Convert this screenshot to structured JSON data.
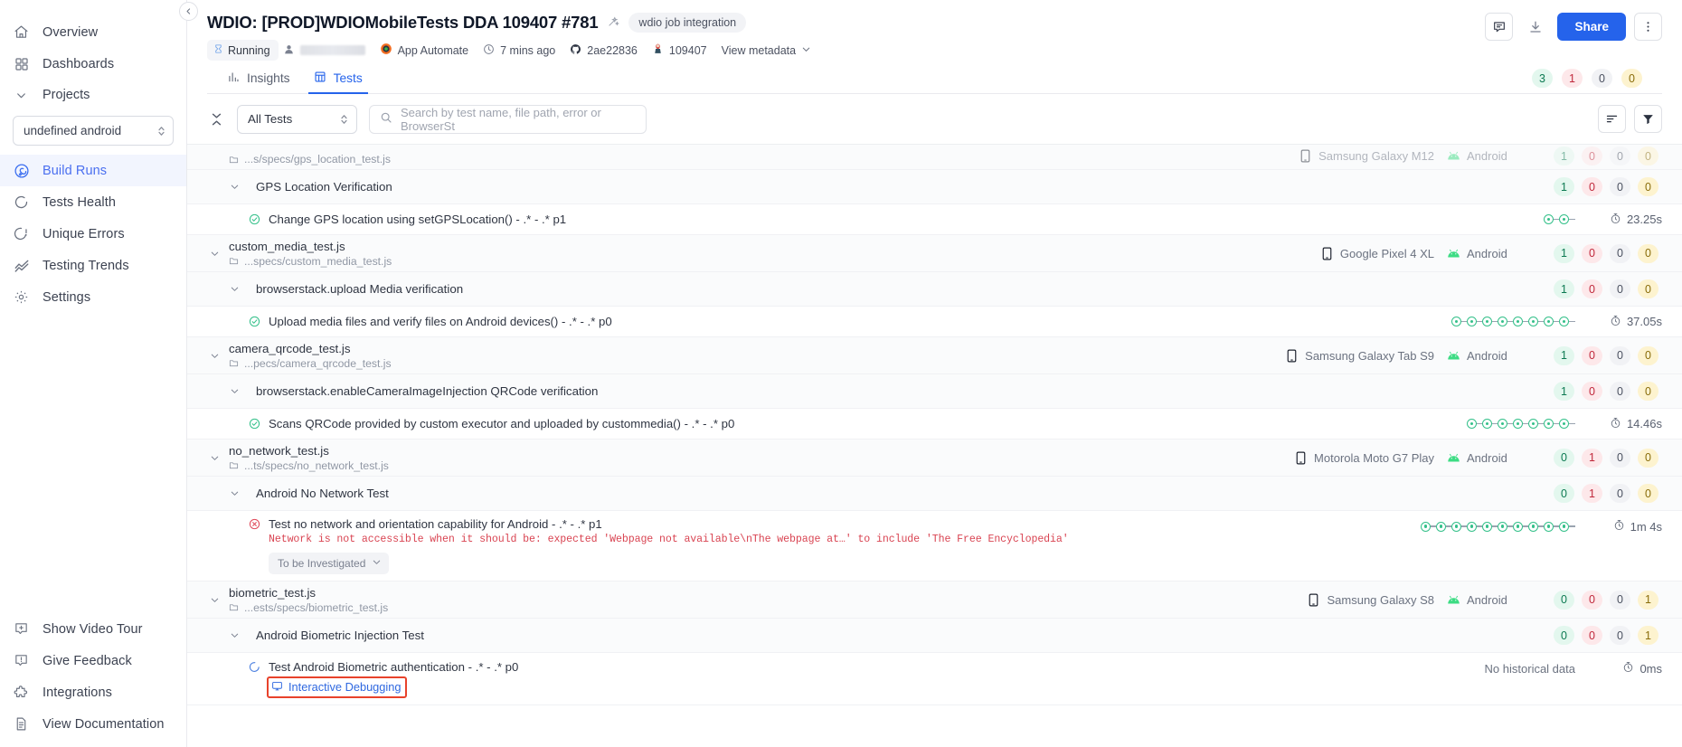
{
  "sidebar": {
    "items_top": [
      {
        "label": "Overview",
        "icon": "home-icon",
        "active": false
      },
      {
        "label": "Dashboards",
        "icon": "grid-icon",
        "active": false
      }
    ],
    "group_label": "Projects",
    "project_select": {
      "value": "undefined android"
    },
    "items_project": [
      {
        "label": "Build Runs",
        "icon": "build-runs-icon",
        "active": true
      },
      {
        "label": "Tests Health",
        "icon": "health-icon",
        "active": false
      },
      {
        "label": "Unique Errors",
        "icon": "unique-errors-icon",
        "active": false
      },
      {
        "label": "Testing Trends",
        "icon": "trends-icon",
        "active": false
      },
      {
        "label": "Settings",
        "icon": "gear-icon",
        "active": false
      }
    ],
    "items_bottom": [
      {
        "label": "Show Video Tour",
        "icon": "video-tour-icon"
      },
      {
        "label": "Give Feedback",
        "icon": "feedback-icon"
      },
      {
        "label": "Integrations",
        "icon": "integrations-icon"
      },
      {
        "label": "View Documentation",
        "icon": "document-icon"
      }
    ]
  },
  "header": {
    "title": "WDIO: [PROD]WDIOMobileTests DDA 109407 #781",
    "tag": "wdio job integration",
    "status": "Running",
    "user": "",
    "product": "App Automate",
    "time_ago": "7 mins ago",
    "commit": "2ae22836",
    "build_number": "109407",
    "view_metadata": "View metadata",
    "share_label": "Share",
    "counts": [
      {
        "value": "3",
        "type": "pass"
      },
      {
        "value": "1",
        "type": "fail"
      },
      {
        "value": "0",
        "type": "skip"
      },
      {
        "value": "0",
        "type": "other"
      }
    ],
    "tabs": [
      {
        "label": "Insights",
        "icon": "insights-icon",
        "active": false
      },
      {
        "label": "Tests",
        "icon": "tests-table-icon",
        "active": true
      }
    ]
  },
  "filter_bar": {
    "collapse_all": "collapse-all-icon",
    "select_value": "All Tests",
    "search_placeholder": "Search by test name, file path, error or BrowserSt",
    "sort_icon": "sort-icon",
    "filter_icon": "filter-icon"
  },
  "rows": [
    {
      "kind": "file",
      "partial": true,
      "name": "",
      "path": "...s/specs/gps_location_test.js",
      "device": "Samsung Galaxy M12",
      "os": "Android",
      "counts": [
        "1",
        "0",
        "0",
        "0"
      ]
    },
    {
      "kind": "suite",
      "name": "GPS Location Verification",
      "counts": [
        "1",
        "0",
        "0",
        "0"
      ]
    },
    {
      "kind": "test",
      "status": "passed",
      "name": "Change GPS location using setGPSLocation() - .* - .* p1",
      "history_dots": 2,
      "duration": "23.25s"
    },
    {
      "kind": "file",
      "name": "custom_media_test.js",
      "path": "...specs/custom_media_test.js",
      "device": "Google Pixel 4 XL",
      "os": "Android",
      "counts": [
        "1",
        "0",
        "0",
        "0"
      ]
    },
    {
      "kind": "suite",
      "name": "browserstack.upload Media verification",
      "counts": [
        "1",
        "0",
        "0",
        "0"
      ]
    },
    {
      "kind": "test",
      "status": "passed",
      "name": "Upload media files and verify files on Android devices() - .* - .* p0",
      "history_dots": 8,
      "duration": "37.05s"
    },
    {
      "kind": "file",
      "name": "camera_qrcode_test.js",
      "path": "...pecs/camera_qrcode_test.js",
      "device": "Samsung Galaxy Tab S9",
      "os": "Android",
      "counts": [
        "1",
        "0",
        "0",
        "0"
      ]
    },
    {
      "kind": "suite",
      "name": "browserstack.enableCameraImageInjection QRCode verification",
      "counts": [
        "1",
        "0",
        "0",
        "0"
      ]
    },
    {
      "kind": "test",
      "status": "passed",
      "name": "Scans QRCode provided by custom executor and uploaded by custommedia() - .* - .* p0",
      "history_dots": 7,
      "duration": "14.46s"
    },
    {
      "kind": "file",
      "name": "no_network_test.js",
      "path": "...ts/specs/no_network_test.js",
      "device": "Motorola Moto G7 Play",
      "os": "Android",
      "counts": [
        "0",
        "1",
        "0",
        "0"
      ]
    },
    {
      "kind": "suite",
      "name": "Android No Network Test",
      "counts": [
        "0",
        "1",
        "0",
        "0"
      ]
    },
    {
      "kind": "test",
      "status": "failed",
      "name": "Test no network and orientation capability for Android - .* - .* p1",
      "error": "Network is not accessible when it should be: expected 'Webpage not available\\nThe webpage at…' to include 'The Free Encyclopedia'",
      "investigate_label": "To be Investigated",
      "history_dots": 10,
      "duration": "1m 4s"
    },
    {
      "kind": "file",
      "name": "biometric_test.js",
      "path": "...ests/specs/biometric_test.js",
      "device": "Samsung Galaxy S8",
      "os": "Android",
      "counts": [
        "0",
        "0",
        "0",
        "1"
      ]
    },
    {
      "kind": "suite",
      "name": "Android Biometric Injection Test",
      "counts": [
        "0",
        "0",
        "0",
        "1"
      ]
    },
    {
      "kind": "test",
      "status": "running",
      "name": "Test Android Biometric authentication - .* - .* p0",
      "debug_link": "Interactive Debugging",
      "history_text": "No historical data",
      "duration": "0ms"
    }
  ],
  "colors": {
    "accent": "#2563eb",
    "pass": "#34c08a",
    "fail": "#d94452",
    "android": "#3ddc84",
    "highlight": "#e8422b"
  }
}
